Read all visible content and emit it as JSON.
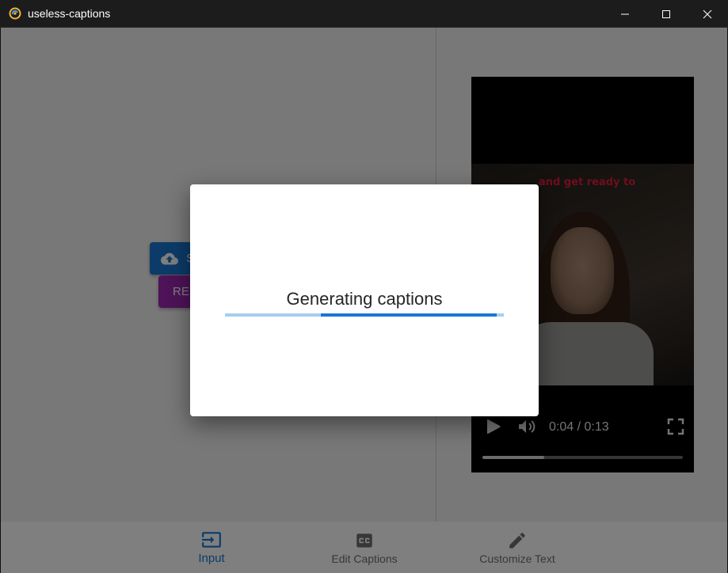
{
  "window": {
    "title": "useless-captions",
    "icon": "app-logo-icon",
    "controls": [
      "minimize-icon",
      "maximize-icon",
      "close-icon"
    ]
  },
  "left_pane": {
    "select_button_label": "S",
    "record_button_label": "RE"
  },
  "video": {
    "caption_overlay": "and get ready to",
    "time": "0:04 / 0:13",
    "progress": 0.31,
    "icons": [
      "play-icon",
      "volume-icon",
      "fullscreen-icon"
    ]
  },
  "bottom_nav": {
    "items": [
      {
        "label": "Input",
        "icon": "input-icon",
        "active": true
      },
      {
        "label": "Edit Captions",
        "icon": "closed-captions-icon",
        "active": false
      },
      {
        "label": "Customize Text",
        "icon": "pencil-icon",
        "active": false
      }
    ]
  },
  "dialog": {
    "title": "Generating captions",
    "progress_indeterminate": true
  },
  "colors": {
    "primary": "#1976d2",
    "record": "#9c27b0",
    "progress_track": "#a8cdf1",
    "caption_red": "#e01b3c"
  }
}
